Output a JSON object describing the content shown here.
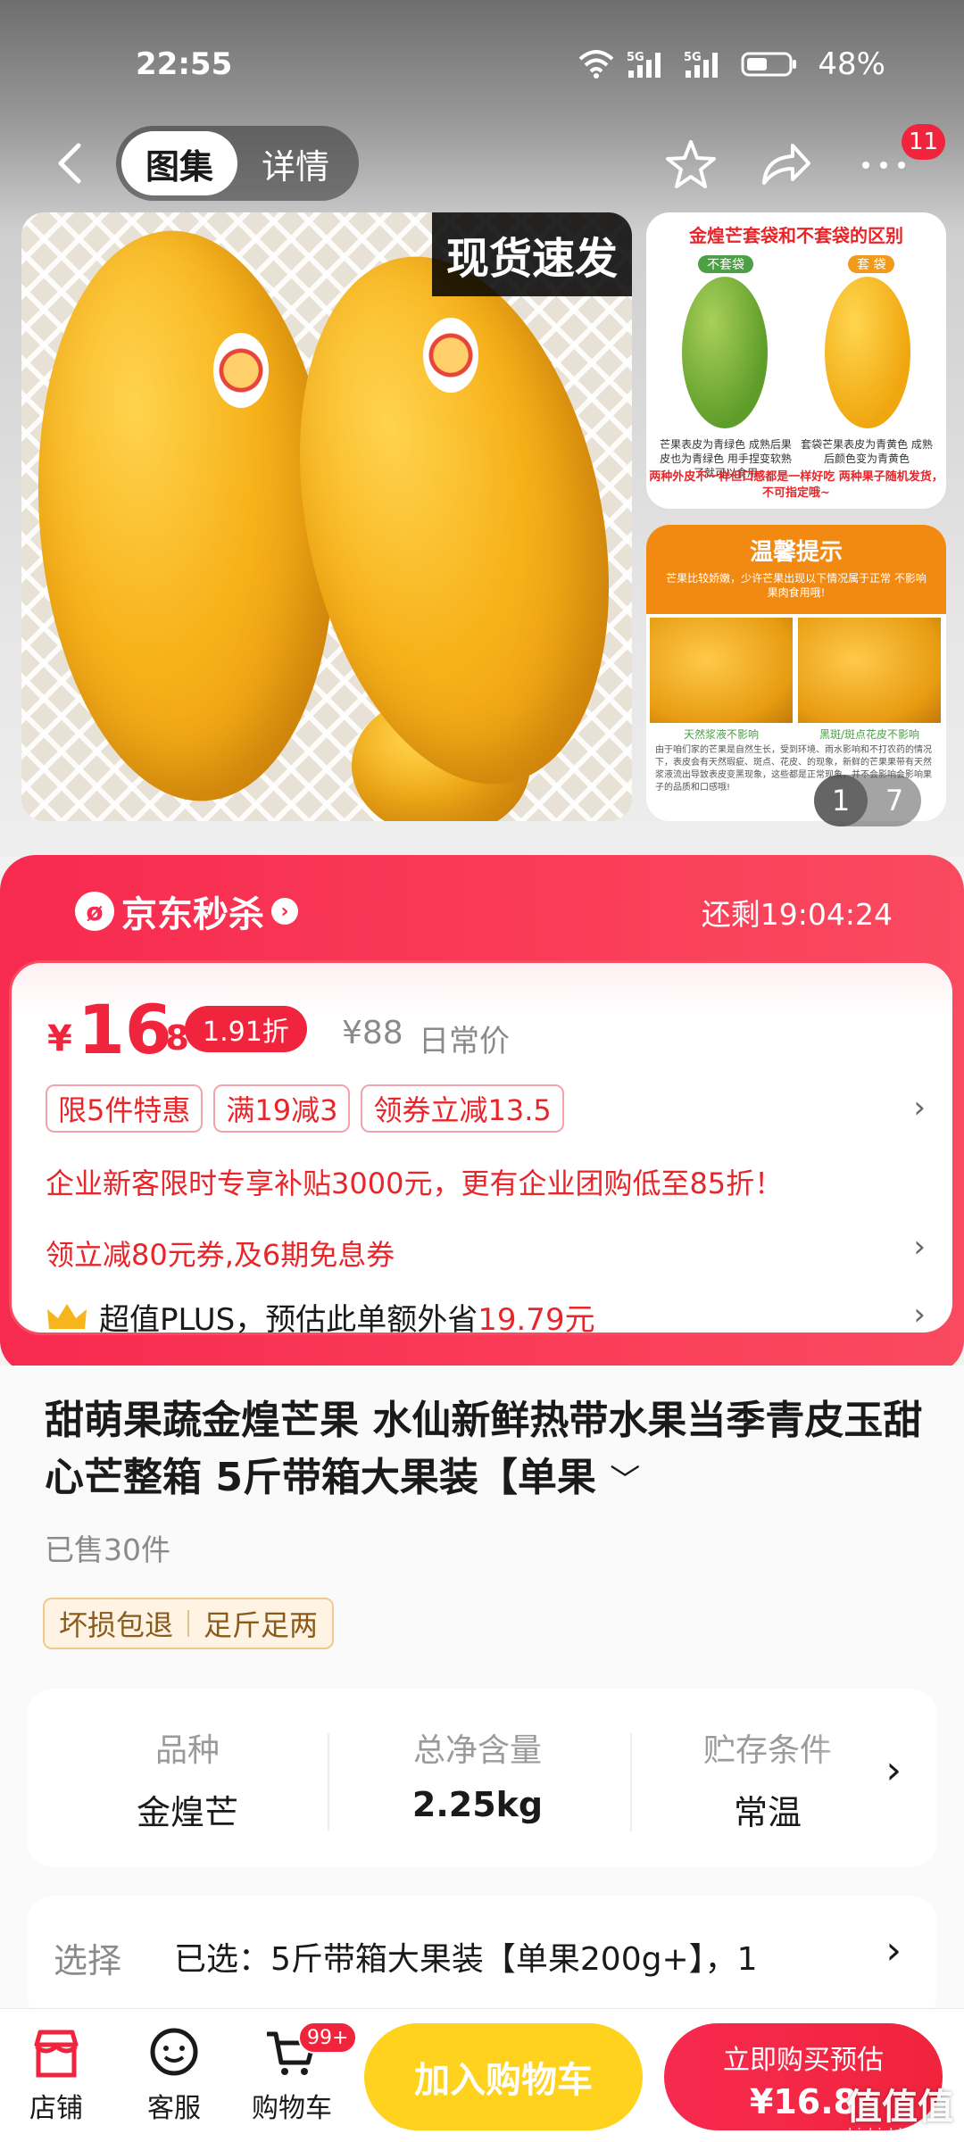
{
  "status_bar": {
    "time": "22:55",
    "net1": "5G",
    "net2": "5G",
    "battery": "48%"
  },
  "nav": {
    "tab_gallery": "图集",
    "tab_detail": "详情",
    "more_badge": "11"
  },
  "gallery": {
    "main_tag": "现货速发",
    "card1": {
      "title": "金煌芒套袋和不套袋的区别",
      "tag_left": "不套袋",
      "tag_right": "套 袋",
      "note_left": "芒果表皮为青绿色 成熟后果皮也为青绿色 用手捏变软熟了就可以食用",
      "note_right": "套袋芒果表皮为青黄色 成熟后颜色变为青黄色",
      "footer": "两种外皮不一样但口感都是一样好吃 两种果子随机发货，不可指定哦~"
    },
    "card2": {
      "title": "温馨提示",
      "subtitle": "芒果比较娇嫩，少许芒果出现以下情况属于正常 不影响果肉食用哦!",
      "cap_left": "天然浆液不影响",
      "cap_right": "黑斑/斑点花皮不影响",
      "body": "由于咱们家的芒果是自然生长，受到环境、雨水影响和不打农药的情况下，表皮会有天然瑕疵、斑点、花皮、的现象，新鲜的芒果果带有天然浆液流出导致表皮变黑现象，这些都是正常现象，并不会影响会影响果子的品质和口感哦!"
    },
    "page_current": "1",
    "page_total": "7"
  },
  "seckill": {
    "title": "京东秒杀",
    "timer": "还剩19:04:24",
    "currency": "¥",
    "price_int": "16",
    "price_dec": ".8",
    "discount": "1.91折",
    "orig_price": "¥88",
    "orig_label": "日常价",
    "promo_tags": [
      "限5件特惠",
      "满19减3",
      "领券立减13.5"
    ],
    "enterprise": "企业新客限时专享补贴3000元，更有企业团购低至85折！",
    "coupon": "领立减80元券,及6期免息券",
    "plus_prefix": "超值PLUS，预估此单额外省",
    "plus_save": "19.79元"
  },
  "product": {
    "title": "甜萌果蔬金煌芒果 水仙新鲜热带水果当季青皮玉甜心芒整箱 5斤带箱大果装【单果",
    "sold": "已售30件",
    "service1": "坏损包退",
    "service2": "足斤足两",
    "specs": [
      {
        "key": "品种",
        "value": "金煌芒"
      },
      {
        "key": "总净含量",
        "value": "2.25kg"
      },
      {
        "key": "贮存条件",
        "value": "常温"
      }
    ],
    "select_label": "选择",
    "select_value": "已选：5斤带箱大果装【单果200g+】，1"
  },
  "bottom": {
    "shop": "店铺",
    "service": "客服",
    "cart": "购物车",
    "cart_badge": "99+",
    "add_cart": "加入购物车",
    "buy_l1": "立即购买预估",
    "buy_l2": "¥16.8",
    "watermark": "值值值",
    "watermark_sub": "zhizhizhi.com"
  },
  "colors": {
    "accent_red": "#f0243c",
    "cart_yellow": "#ffd21e"
  }
}
